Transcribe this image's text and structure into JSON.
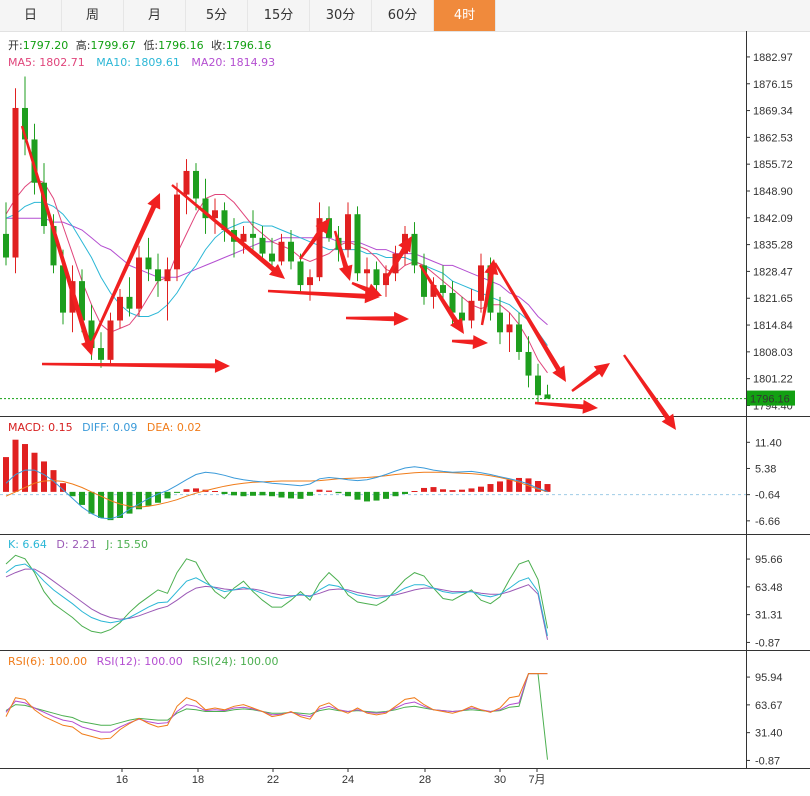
{
  "tabs": [
    {
      "label": "日",
      "active": false
    },
    {
      "label": "周",
      "active": false
    },
    {
      "label": "月",
      "active": false
    },
    {
      "label": "5分",
      "active": false
    },
    {
      "label": "15分",
      "active": false
    },
    {
      "label": "30分",
      "active": false
    },
    {
      "label": "60分",
      "active": false
    },
    {
      "label": "4时",
      "active": true
    }
  ],
  "ohlc": {
    "open_label": "开:",
    "open": "1797.20",
    "high_label": "高:",
    "high": "1799.67",
    "low_label": "低:",
    "low": "1796.16",
    "close_label": "收:",
    "close": "1796.16"
  },
  "ma_legend": [
    {
      "label": "MA5: 1802.71",
      "color": "#e0457b"
    },
    {
      "label": "MA10: 1809.61",
      "color": "#2bb7d6"
    },
    {
      "label": "MA20: 1814.93",
      "color": "#b44fd1"
    }
  ],
  "macd_legend": [
    {
      "label": "MACD: 0.15",
      "color": "#d62020"
    },
    {
      "label": "DIFF: 0.09",
      "color": "#3a9ad9"
    },
    {
      "label": "DEA: 0.02",
      "color": "#f07c1a"
    }
  ],
  "kdj_legend": [
    {
      "label": "K: 6.64",
      "color": "#2bb7d6"
    },
    {
      "label": "D: 2.21",
      "color": "#9b59b6"
    },
    {
      "label": "J: 15.50",
      "color": "#4caf50"
    }
  ],
  "rsi_legend": [
    {
      "label": "RSI(6): 100.00",
      "color": "#f07c1a"
    },
    {
      "label": "RSI(12): 100.00",
      "color": "#b44fd1"
    },
    {
      "label": "RSI(24): 100.00",
      "color": "#4caf50"
    }
  ],
  "price_axis_ticks": [
    "1882.97",
    "1876.15",
    "1869.34",
    "1862.53",
    "1855.72",
    "1848.90",
    "1842.09",
    "1835.28",
    "1828.47",
    "1821.65",
    "1814.84",
    "1808.03",
    "1801.22",
    "1794.40"
  ],
  "current_price": "1796.16",
  "macd_axis_ticks": [
    "11.40",
    "5.38",
    "-0.64",
    "-6.66"
  ],
  "kdj_axis_ticks": [
    "95.66",
    "63.48",
    "31.31",
    "-0.87"
  ],
  "rsi_axis_ticks": [
    "95.94",
    "63.67",
    "31.40",
    "-0.87"
  ],
  "date_labels": [
    "16",
    "18",
    "22",
    "24",
    "28",
    "30",
    "7月"
  ],
  "colors": {
    "up": "#e02020",
    "down": "#1e9e1e",
    "arrow": "#f02020",
    "current": "#12a012"
  },
  "chart_data": {
    "type": "candlestick",
    "interval": "4时",
    "y_range": [
      1793.0,
      1886.0
    ],
    "candles": [
      [
        1838,
        1846,
        1830,
        1832
      ],
      [
        1832,
        1875,
        1828,
        1870
      ],
      [
        1870,
        1878,
        1858,
        1862
      ],
      [
        1862,
        1866,
        1848,
        1851
      ],
      [
        1851,
        1856,
        1838,
        1840
      ],
      [
        1840,
        1843,
        1828,
        1830
      ],
      [
        1830,
        1834,
        1815,
        1818
      ],
      [
        1818,
        1830,
        1813,
        1826
      ],
      [
        1826,
        1829,
        1813,
        1816
      ],
      [
        1816,
        1820,
        1806,
        1809
      ],
      [
        1809,
        1813,
        1804,
        1806
      ],
      [
        1806,
        1818,
        1805,
        1816
      ],
      [
        1816,
        1824,
        1814,
        1822
      ],
      [
        1822,
        1827,
        1817,
        1819
      ],
      [
        1819,
        1835,
        1817,
        1832
      ],
      [
        1832,
        1837,
        1826,
        1829
      ],
      [
        1829,
        1833,
        1822,
        1826
      ],
      [
        1826,
        1832,
        1816,
        1829
      ],
      [
        1829,
        1851,
        1826,
        1848
      ],
      [
        1848,
        1857,
        1843,
        1854
      ],
      [
        1854,
        1856,
        1844,
        1847
      ],
      [
        1847,
        1852,
        1838,
        1842
      ],
      [
        1842,
        1847,
        1838,
        1844
      ],
      [
        1844,
        1846,
        1836,
        1839
      ],
      [
        1839,
        1842,
        1832,
        1836
      ],
      [
        1836,
        1840,
        1833,
        1838
      ],
      [
        1838,
        1844,
        1834,
        1837
      ],
      [
        1837,
        1840,
        1831,
        1833
      ],
      [
        1833,
        1837,
        1829,
        1831
      ],
      [
        1831,
        1838,
        1830,
        1836
      ],
      [
        1836,
        1839,
        1829,
        1831
      ],
      [
        1831,
        1833,
        1823,
        1825
      ],
      [
        1825,
        1829,
        1821,
        1827
      ],
      [
        1827,
        1846,
        1826,
        1842
      ],
      [
        1842,
        1845,
        1836,
        1837
      ],
      [
        1837,
        1840,
        1831,
        1834
      ],
      [
        1834,
        1846,
        1832,
        1843
      ],
      [
        1843,
        1845,
        1826,
        1828
      ],
      [
        1828,
        1832,
        1823,
        1829
      ],
      [
        1829,
        1831,
        1822,
        1825
      ],
      [
        1825,
        1830,
        1822,
        1828
      ],
      [
        1828,
        1835,
        1826,
        1833
      ],
      [
        1833,
        1840,
        1830,
        1838
      ],
      [
        1838,
        1841,
        1828,
        1830
      ],
      [
        1830,
        1833,
        1820,
        1822
      ],
      [
        1822,
        1827,
        1819,
        1825
      ],
      [
        1825,
        1830,
        1821,
        1823
      ],
      [
        1823,
        1826,
        1815,
        1818
      ],
      [
        1818,
        1822,
        1814,
        1816
      ],
      [
        1816,
        1824,
        1814,
        1821
      ],
      [
        1821,
        1833,
        1818,
        1830
      ],
      [
        1830,
        1832,
        1816,
        1818
      ],
      [
        1818,
        1822,
        1810,
        1813
      ],
      [
        1813,
        1818,
        1808,
        1815
      ],
      [
        1815,
        1818,
        1806,
        1808
      ],
      [
        1808,
        1812,
        1799,
        1802
      ],
      [
        1802,
        1805,
        1795,
        1797
      ],
      [
        1797.2,
        1799.67,
        1796.16,
        1796.16
      ]
    ],
    "ma": {
      "MA5": [
        1843,
        1847,
        1850,
        1852,
        1851,
        1847,
        1840,
        1833,
        1826,
        1820,
        1815,
        1813,
        1814,
        1815,
        1818,
        1822,
        1826,
        1827,
        1833,
        1838,
        1843,
        1847,
        1848,
        1848,
        1846,
        1843,
        1840,
        1838,
        1836,
        1835,
        1834,
        1832,
        1831,
        1832,
        1833,
        1835,
        1836,
        1835,
        1834,
        1832,
        1829,
        1828,
        1830,
        1831,
        1830,
        1828,
        1826,
        1824,
        1822,
        1820,
        1819,
        1820,
        1820,
        1818,
        1815,
        1811,
        1806,
        1802.71
      ],
      "MA10": [
        1842,
        1843,
        1845,
        1846,
        1846,
        1845,
        1843,
        1840,
        1836,
        1832,
        1827,
        1823,
        1820,
        1818,
        1817,
        1817,
        1818,
        1820,
        1823,
        1827,
        1830,
        1834,
        1837,
        1839,
        1840,
        1841,
        1841,
        1840,
        1840,
        1839,
        1838,
        1837,
        1836,
        1835,
        1834,
        1834,
        1834,
        1834,
        1833,
        1833,
        1832,
        1832,
        1832,
        1831,
        1830,
        1829,
        1828,
        1826,
        1825,
        1824,
        1823,
        1822,
        1821,
        1820,
        1818,
        1816,
        1813,
        1809.61
      ],
      "MA20": [
        1842,
        1842,
        1842,
        1842,
        1842,
        1841,
        1841,
        1840,
        1839,
        1837,
        1835,
        1834,
        1832,
        1830,
        1829,
        1828,
        1827,
        1827,
        1827,
        1828,
        1829,
        1830,
        1831,
        1832,
        1833,
        1834,
        1835,
        1836,
        1836,
        1837,
        1837,
        1837,
        1837,
        1837,
        1837,
        1836,
        1836,
        1836,
        1835,
        1834,
        1834,
        1833,
        1833,
        1833,
        1832,
        1831,
        1830,
        1830,
        1829,
        1828,
        1827,
        1826,
        1825,
        1823,
        1822,
        1820,
        1817,
        1814.93
      ]
    },
    "macd": {
      "hist": [
        8,
        12,
        11,
        9,
        7,
        5,
        2,
        -1,
        -3,
        -5,
        -6,
        -6.5,
        -6,
        -5,
        -4,
        -3.2,
        -2.5,
        -1.5,
        -0.2,
        0.6,
        0.8,
        0.5,
        0.2,
        -0.5,
        -0.8,
        -1,
        -0.9,
        -0.8,
        -1,
        -1.3,
        -1.5,
        -1.6,
        -0.9,
        0.5,
        0.3,
        -0.3,
        -1,
        -1.8,
        -2.2,
        -2,
        -1.6,
        -1,
        -0.5,
        0.2,
        0.9,
        1.1,
        0.6,
        0.4,
        0.5,
        0.8,
        1.2,
        1.8,
        2.4,
        2.8,
        3.2,
        3.1,
        2.5,
        1.8
      ],
      "diff": [
        2,
        4,
        5,
        5,
        4,
        2.5,
        0.5,
        -1.5,
        -3.5,
        -5,
        -6,
        -6.2,
        -5.5,
        -4,
        -2.8,
        -1.5,
        -0.5,
        0.3,
        1.5,
        2.8,
        4,
        4.5,
        4.3,
        3.8,
        3.2,
        2.8,
        2.5,
        2.3,
        2,
        1.8,
        1.6,
        1.4,
        1.8,
        3,
        3.3,
        3.1,
        2.8,
        2.6,
        2.8,
        3.3,
        4,
        4.8,
        5.5,
        5.8,
        5.5,
        5,
        4.7,
        4.5,
        4.6,
        4.7,
        4.4,
        4,
        3.5,
        3,
        2.5,
        1.8,
        0.8,
        0.09
      ],
      "dea": [
        -1,
        0,
        1,
        2,
        2.5,
        2.6,
        2.4,
        1.8,
        1,
        0,
        -1,
        -2,
        -2.8,
        -3.3,
        -3.5,
        -3.3,
        -2.9,
        -2.4,
        -1.8,
        -1,
        -0.3,
        0.3,
        0.8,
        1.3,
        1.7,
        2,
        2.2,
        2.3,
        2.4,
        2.5,
        2.5,
        2.5,
        2.5,
        2.6,
        2.8,
        3,
        3.1,
        3.2,
        3.3,
        3.5,
        3.7,
        4,
        4.2,
        4.4,
        4.5,
        4.5,
        4.5,
        4.4,
        4.3,
        4.2,
        4,
        3.7,
        3.3,
        2.8,
        2.2,
        1.4,
        0.6,
        0.02
      ]
    },
    "kdj": {
      "K": [
        80,
        88,
        90,
        82,
        70,
        60,
        52,
        44,
        35,
        28,
        24,
        22,
        24,
        28,
        34,
        40,
        45,
        46,
        58,
        70,
        74,
        68,
        62,
        58,
        60,
        63,
        60,
        56,
        52,
        50,
        52,
        55,
        52,
        60,
        66,
        64,
        58,
        54,
        52,
        50,
        52,
        56,
        62,
        66,
        66,
        62,
        58,
        56,
        57,
        58,
        54,
        52,
        55,
        62,
        70,
        74,
        58,
        6.64
      ],
      "D": [
        75,
        80,
        84,
        84,
        78,
        70,
        62,
        54,
        46,
        38,
        32,
        28,
        26,
        27,
        30,
        34,
        38,
        41,
        48,
        56,
        62,
        64,
        63,
        61,
        60,
        61,
        61,
        59,
        56,
        54,
        53,
        54,
        53,
        56,
        60,
        61,
        60,
        57,
        55,
        53,
        53,
        54,
        57,
        60,
        62,
        62,
        60,
        58,
        58,
        58,
        56,
        55,
        55,
        58,
        62,
        66,
        55,
        2.21
      ],
      "J": [
        90,
        100,
        96,
        80,
        58,
        44,
        36,
        28,
        18,
        12,
        10,
        14,
        22,
        34,
        44,
        52,
        60,
        56,
        80,
        96,
        92,
        72,
        58,
        50,
        62,
        70,
        58,
        48,
        40,
        40,
        48,
        58,
        48,
        68,
        80,
        70,
        54,
        46,
        44,
        42,
        48,
        60,
        72,
        80,
        76,
        62,
        50,
        48,
        54,
        60,
        48,
        44,
        52,
        72,
        90,
        94,
        72,
        15.5
      ]
    },
    "rsi": {
      "RSI6": [
        50,
        72,
        70,
        58,
        50,
        45,
        40,
        38,
        30,
        27,
        24,
        25,
        35,
        42,
        48,
        42,
        38,
        40,
        62,
        72,
        68,
        58,
        60,
        58,
        62,
        64,
        60,
        56,
        50,
        52,
        56,
        50,
        47,
        62,
        66,
        58,
        54,
        60,
        54,
        52,
        54,
        62,
        70,
        72,
        64,
        58,
        56,
        54,
        57,
        62,
        58,
        55,
        60,
        72,
        74,
        100,
        100,
        100
      ],
      "RSI12": [
        55,
        68,
        66,
        60,
        55,
        50,
        46,
        44,
        38,
        35,
        32,
        32,
        38,
        43,
        47,
        44,
        42,
        43,
        56,
        64,
        62,
        57,
        58,
        57,
        60,
        61,
        59,
        56,
        52,
        53,
        55,
        52,
        50,
        59,
        62,
        58,
        56,
        58,
        55,
        54,
        55,
        60,
        65,
        67,
        62,
        58,
        57,
        56,
        57,
        60,
        58,
        56,
        58,
        64,
        66,
        100,
        100,
        100
      ],
      "RSI24": [
        57,
        64,
        63,
        60,
        57,
        54,
        51,
        49,
        44,
        42,
        40,
        40,
        43,
        46,
        48,
        47,
        46,
        46,
        54,
        59,
        58,
        56,
        56,
        56,
        58,
        59,
        58,
        56,
        54,
        54,
        55,
        54,
        53,
        57,
        59,
        57,
        56,
        57,
        56,
        55,
        56,
        58,
        61,
        62,
        60,
        58,
        57,
        56,
        57,
        58,
        57,
        56,
        57,
        61,
        62,
        100,
        100,
        0
      ]
    }
  }
}
